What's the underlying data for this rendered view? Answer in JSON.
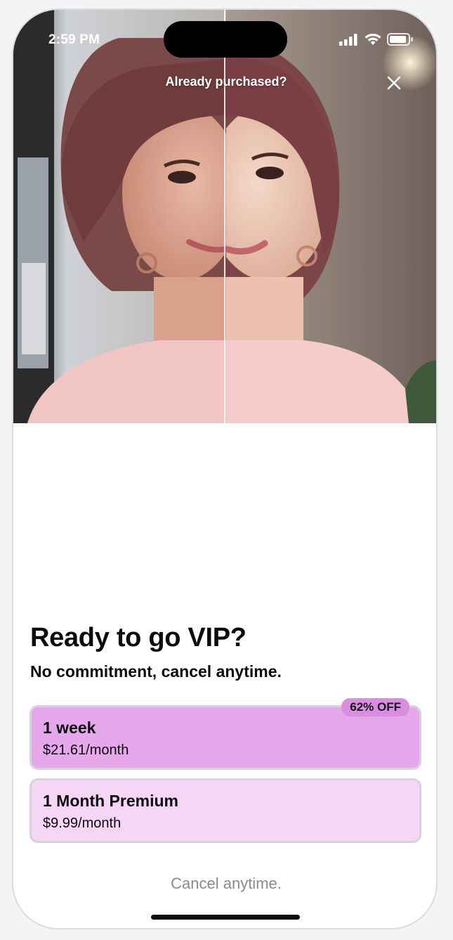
{
  "status_bar": {
    "time": "2:59 PM",
    "icons": [
      "cellular-signal-icon",
      "wifi-icon",
      "battery-icon"
    ]
  },
  "header": {
    "restore_label": "Already purchased?",
    "close_icon": "close-icon"
  },
  "hero": {
    "description_hidden": true
  },
  "paywall": {
    "title": "Ready to go VIP?",
    "subtitle": "No commitment, cancel anytime.",
    "plans": [
      {
        "name": "1 week",
        "price": "$21.61/month",
        "badge": "62% OFF",
        "selected": true
      },
      {
        "name": "1 Month Premium",
        "price": "$9.99/month",
        "selected": false
      }
    ],
    "footer_note": "Cancel anytime."
  },
  "colors": {
    "selected_plan_bg": "#e6a8eb",
    "unselected_plan_bg": "#f5d6f5",
    "badge_bg": "#d98ee0",
    "plan_border": "#d6d3dc",
    "footer_text": "#8a8a90"
  }
}
